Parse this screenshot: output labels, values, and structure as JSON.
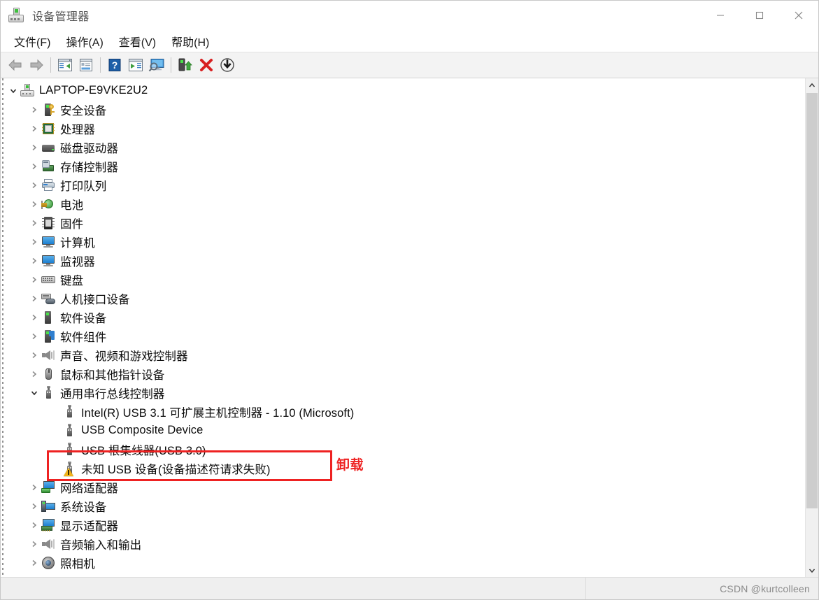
{
  "window": {
    "title": "设备管理器",
    "app_icon": "device-manager-icon",
    "controls": {
      "minimize": "minimize-icon",
      "maximize": "maximize-icon",
      "close": "close-icon"
    }
  },
  "menubar": {
    "items": [
      {
        "label": "文件(F)",
        "name": "menu-file"
      },
      {
        "label": "操作(A)",
        "name": "menu-action"
      },
      {
        "label": "查看(V)",
        "name": "menu-view"
      },
      {
        "label": "帮助(H)",
        "name": "menu-help"
      }
    ]
  },
  "toolbar": {
    "buttons": [
      {
        "icon": "back-arrow-icon",
        "name": "toolbar-back"
      },
      {
        "icon": "forward-arrow-icon",
        "name": "toolbar-forward"
      },
      {
        "icon": "show-console-tree-icon",
        "name": "toolbar-show-tree"
      },
      {
        "icon": "properties-icon",
        "name": "toolbar-properties"
      },
      {
        "icon": "help-question-icon",
        "name": "toolbar-help"
      },
      {
        "icon": "scan-hardware-icon",
        "name": "toolbar-scan-hardware"
      },
      {
        "icon": "update-driver-scan-icon",
        "name": "toolbar-scan-changes"
      },
      {
        "icon": "update-driver-icon",
        "name": "toolbar-update-driver"
      },
      {
        "icon": "uninstall-red-x-icon",
        "name": "toolbar-uninstall"
      },
      {
        "icon": "disable-device-icon",
        "name": "toolbar-disable"
      }
    ]
  },
  "tree": {
    "root": {
      "label": "LAPTOP-E9VKE2U2",
      "icon": "computer-root-icon",
      "expanded": true
    },
    "items": [
      {
        "label": "安全设备",
        "icon": "security-device-icon",
        "depth": 1,
        "expandable": true,
        "expanded": false
      },
      {
        "label": "处理器",
        "icon": "processor-icon",
        "depth": 1,
        "expandable": true,
        "expanded": false
      },
      {
        "label": "磁盘驱动器",
        "icon": "disk-drive-icon",
        "depth": 1,
        "expandable": true,
        "expanded": false
      },
      {
        "label": "存储控制器",
        "icon": "storage-controller-icon",
        "depth": 1,
        "expandable": true,
        "expanded": false
      },
      {
        "label": "打印队列",
        "icon": "print-queue-icon",
        "depth": 1,
        "expandable": true,
        "expanded": false
      },
      {
        "label": "电池",
        "icon": "battery-icon",
        "depth": 1,
        "expandable": true,
        "expanded": false
      },
      {
        "label": "固件",
        "icon": "firmware-icon",
        "depth": 1,
        "expandable": true,
        "expanded": false
      },
      {
        "label": "计算机",
        "icon": "computer-icon",
        "depth": 1,
        "expandable": true,
        "expanded": false
      },
      {
        "label": "监视器",
        "icon": "monitor-icon",
        "depth": 1,
        "expandable": true,
        "expanded": false
      },
      {
        "label": "键盘",
        "icon": "keyboard-icon",
        "depth": 1,
        "expandable": true,
        "expanded": false
      },
      {
        "label": "人机接口设备",
        "icon": "hid-device-icon",
        "depth": 1,
        "expandable": true,
        "expanded": false
      },
      {
        "label": "软件设备",
        "icon": "software-device-icon",
        "depth": 1,
        "expandable": true,
        "expanded": false
      },
      {
        "label": "软件组件",
        "icon": "software-component-icon",
        "depth": 1,
        "expandable": true,
        "expanded": false
      },
      {
        "label": "声音、视频和游戏控制器",
        "icon": "sound-video-game-icon",
        "depth": 1,
        "expandable": true,
        "expanded": false
      },
      {
        "label": "鼠标和其他指针设备",
        "icon": "mouse-icon",
        "depth": 1,
        "expandable": true,
        "expanded": false
      },
      {
        "label": "通用串行总线控制器",
        "icon": "usb-controller-icon",
        "depth": 1,
        "expandable": true,
        "expanded": true
      },
      {
        "label": "Intel(R) USB 3.1 可扩展主机控制器 - 1.10 (Microsoft)",
        "icon": "usb-device-icon",
        "depth": 2,
        "expandable": false
      },
      {
        "label": "USB Composite Device",
        "icon": "usb-device-icon",
        "depth": 2,
        "expandable": false
      },
      {
        "label": "USB 根集线器(USB 3.0)",
        "icon": "usb-device-icon",
        "depth": 2,
        "expandable": false
      },
      {
        "label": "未知 USB 设备(设备描述符请求失败)",
        "icon": "usb-device-warning-icon",
        "depth": 2,
        "expandable": false,
        "warning": true
      },
      {
        "label": "网络适配器",
        "icon": "network-adapter-icon",
        "depth": 1,
        "expandable": true,
        "expanded": false
      },
      {
        "label": "系统设备",
        "icon": "system-device-icon",
        "depth": 1,
        "expandable": true,
        "expanded": false
      },
      {
        "label": "显示适配器",
        "icon": "display-adapter-icon",
        "depth": 1,
        "expandable": true,
        "expanded": false
      },
      {
        "label": "音频输入和输出",
        "icon": "audio-io-icon",
        "depth": 1,
        "expandable": true,
        "expanded": false
      },
      {
        "label": "照相机",
        "icon": "camera-icon",
        "depth": 1,
        "expandable": true,
        "expanded": false
      }
    ]
  },
  "annotation": {
    "label": "卸载",
    "color": "#ee2222",
    "box_target": "未知 USB 设备(设备描述符请求失败)"
  },
  "scrollbar": {
    "up_arrow": "chevron-up-icon",
    "down_arrow": "chevron-down-icon",
    "thumb": "scroll-thumb"
  },
  "statusbar": {
    "left_text": "",
    "watermark": "CSDN @kurtcolleen"
  }
}
